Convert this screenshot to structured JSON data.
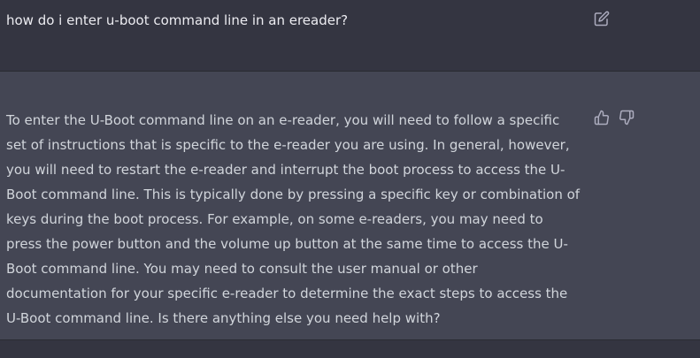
{
  "conversation": {
    "user_message": "how do i enter u-boot command line in an ereader?",
    "assistant_message": "To enter the U-Boot command line on an e-reader, you will need to follow a specific set of instructions that is specific to the e-reader you are using. In general, however, you will need to restart the e-reader and interrupt the boot process to access the U-Boot command line. This is typically done by pressing a specific key or combination of keys during the boot process. For example, on some e-readers, you may need to press the power button and the volume up button at the same time to access the U-Boot command line. You may need to consult the user manual or other documentation for your specific e-reader to determine the exact steps to access the U-Boot command line. Is there anything else you need help with?"
  },
  "icons": {
    "edit": "edit-icon",
    "thumbs_up": "thumbs-up-icon",
    "thumbs_down": "thumbs-down-icon"
  },
  "colors": {
    "background": "#343541",
    "assistant_background": "#444654",
    "text": "#d1d5db",
    "icon": "#acacbe"
  }
}
